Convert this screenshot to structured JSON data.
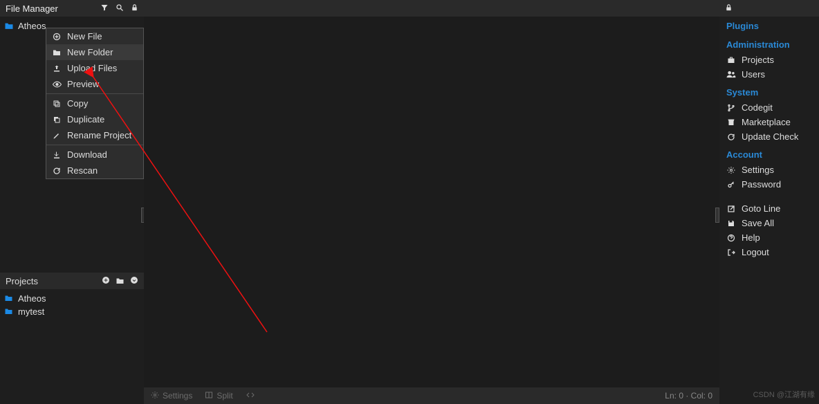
{
  "file_manager": {
    "title": "File Manager",
    "root_folder": "Atheos"
  },
  "context_menu": {
    "new_file": "New File",
    "new_folder": "New Folder",
    "upload_files": "Upload Files",
    "preview": "Preview",
    "copy": "Copy",
    "duplicate": "Duplicate",
    "rename_project": "Rename Project",
    "download": "Download",
    "rescan": "Rescan"
  },
  "projects": {
    "title": "Projects",
    "items": [
      "Atheos",
      "mytest"
    ]
  },
  "editor_bottom": {
    "settings": "Settings",
    "split": "Split",
    "status": "Ln: 0 · Col: 0"
  },
  "right_panel": {
    "plugins_heading": "Plugins",
    "admin_heading": "Administration",
    "admin": {
      "projects": "Projects",
      "users": "Users"
    },
    "system_heading": "System",
    "system": {
      "codegit": "Codegit",
      "marketplace": "Marketplace",
      "update_check": "Update Check"
    },
    "account_heading": "Account",
    "account": {
      "settings": "Settings",
      "password": "Password"
    },
    "misc": {
      "goto_line": "Goto Line",
      "save_all": "Save All",
      "help": "Help",
      "logout": "Logout"
    }
  },
  "watermark": "CSDN @江湖有缘"
}
